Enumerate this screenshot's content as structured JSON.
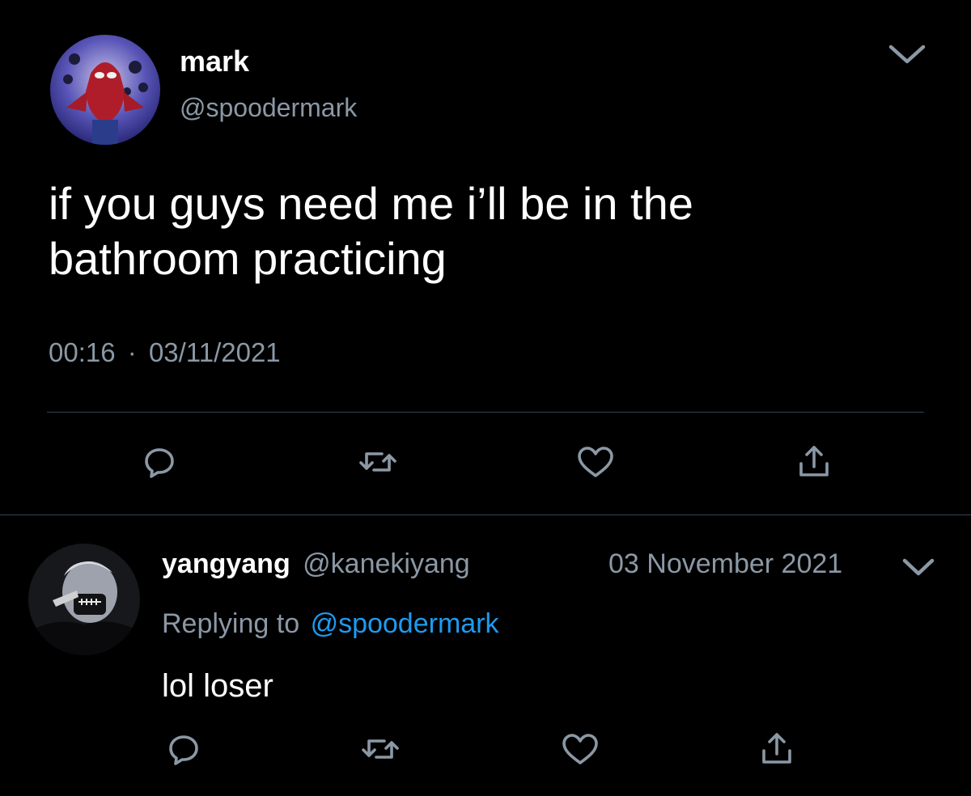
{
  "main_tweet": {
    "display_name": "mark",
    "handle": "@spoodermark",
    "text": "if you guys need me i’ll be in the bathroom practicing",
    "time": "00:16",
    "separator": "·",
    "date": "03/11/2021",
    "avatar_icon": "spiderman-avatar",
    "menu_icon": "chevron-down-icon"
  },
  "reply": {
    "display_name": "yangyang",
    "handle": "@kanekiyang",
    "date": "03 November 2021",
    "replying_prefix": "Replying to",
    "replying_handle": "@spoodermark",
    "text": "lol loser",
    "avatar_icon": "masked-person-avatar",
    "menu_icon": "chevron-down-icon"
  },
  "actions": [
    "reply-icon",
    "retweet-icon",
    "like-icon",
    "share-icon"
  ],
  "colors": {
    "background": "#000000",
    "text": "#ffffff",
    "muted": "#8b98a5",
    "link": "#1d9bf0",
    "divider": "#38444d"
  }
}
